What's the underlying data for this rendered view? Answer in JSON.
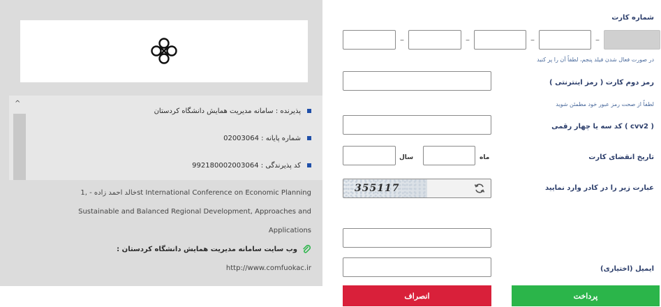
{
  "form": {
    "card_number_label": "شماره کارت",
    "card_hint": "در صورت فعال شدن فیلد پنجم، لطفاً آن را پر کنید",
    "second_password_label": "رمز دوم کارت ( رمز اینترنتی )",
    "password_hint": "لطفاً از صحت رمز عبور خود مطمئن شوید",
    "cvv2_label": "کد سه یا چهار رقمی ( cvv2 )",
    "expiry_label": "تاریخ انقضای کارت",
    "month_label": "ماه",
    "year_label": "سال",
    "captcha_label": "عبارت زیر را در کادر وارد نمایید",
    "captcha_code": "355117",
    "email_label": "ایمیل (اختیاری)",
    "pay_button": "پرداخت",
    "cancel_button": "انصراف"
  },
  "merchant": {
    "items": [
      "پذیرنده : سامانه مدیریت همایش دانشگاه کردستان",
      "شماره پایانه : 02003064",
      "کد پذیرندگی : 992180002003064"
    ],
    "description_lines": [
      "خالد احمد زاده - ,1st International Conference on Economic Planning",
      "Sustainable and Balanced Regional Development, Approaches and",
      "Applications"
    ],
    "website_label": "وب سایت سامانه مدیریت همایش دانشگاه کردستان :",
    "website_url": "http://www.comfuokac.ir"
  },
  "icons": {
    "logo": "bank-logo-icon",
    "refresh": "refresh-icon",
    "paperclip": "paperclip-icon",
    "scroll_up": "chevron-up-icon"
  },
  "colors": {
    "pay": "#2bb54a",
    "cancel": "#d9203a",
    "bullet": "#1f4fa8",
    "label": "#2c3e6b"
  }
}
